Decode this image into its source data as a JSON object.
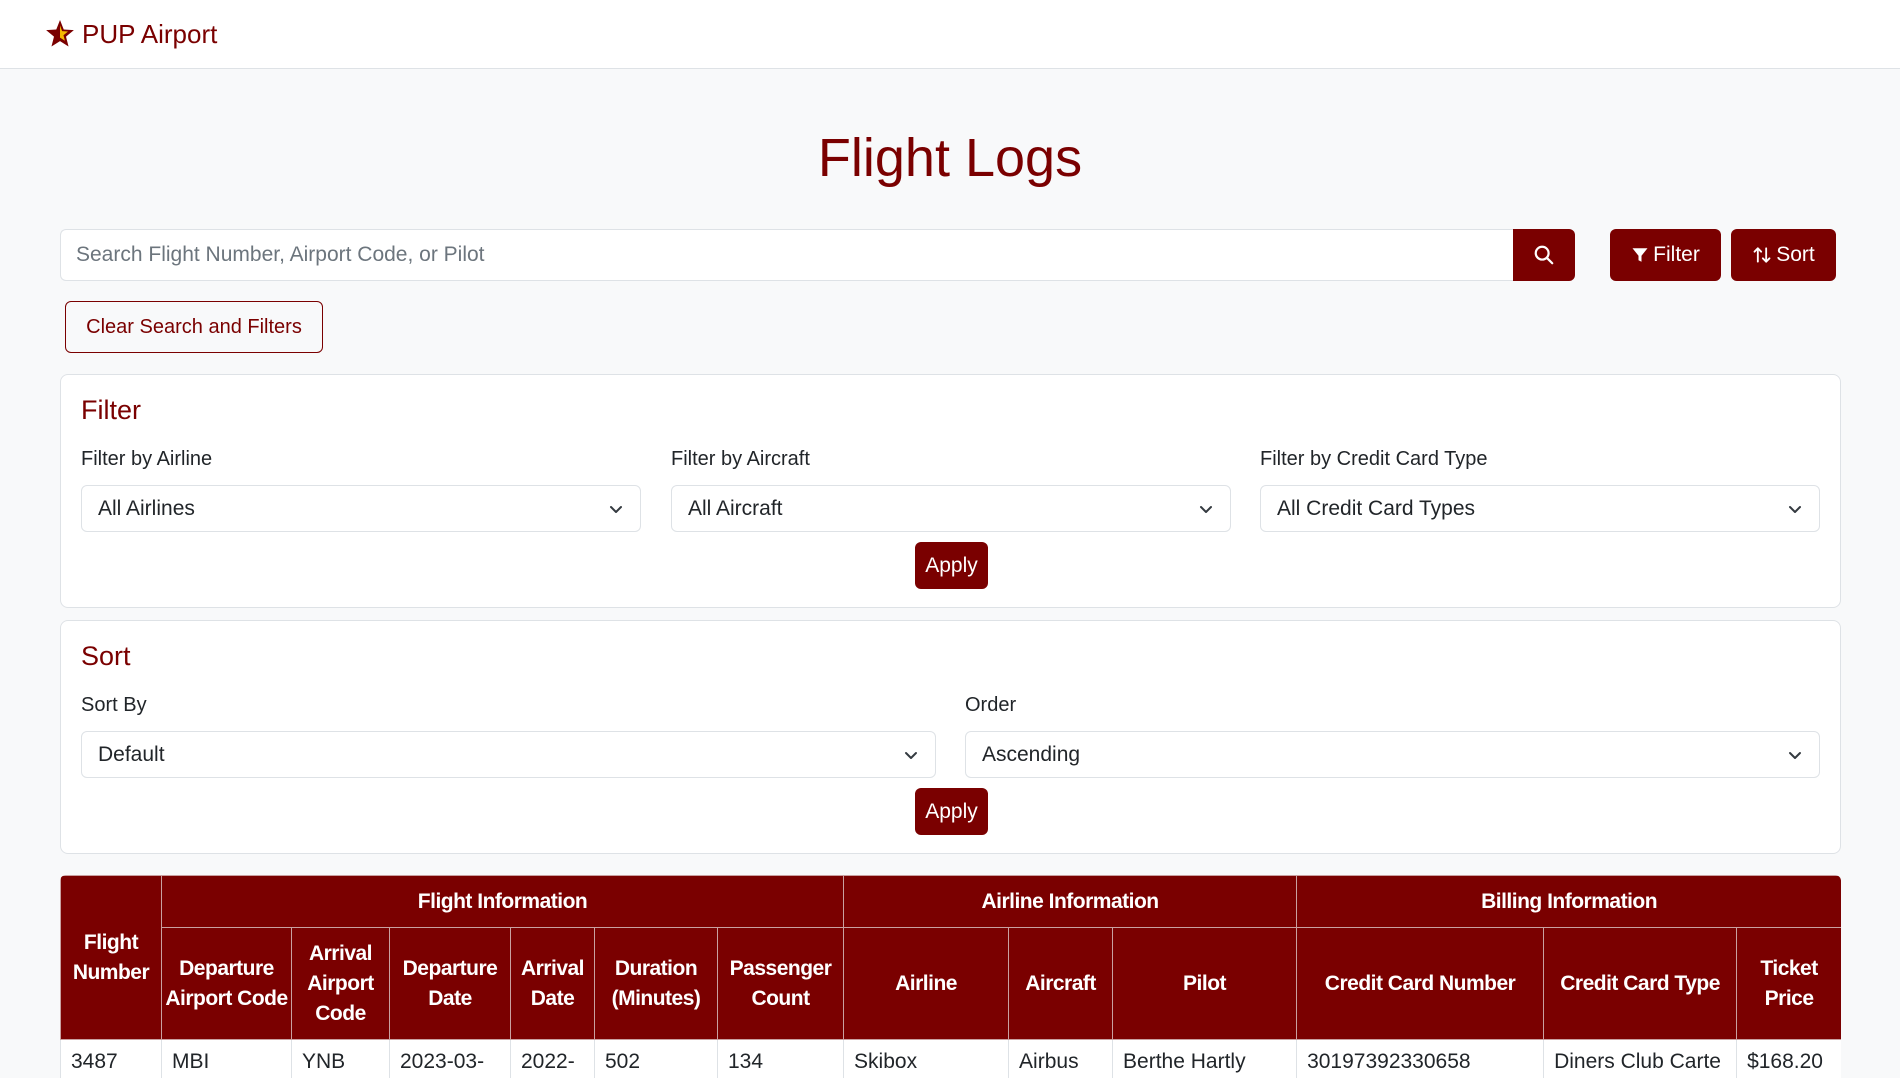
{
  "navbar": {
    "brand_text": "PUP Airport",
    "brand_icon": "star-icon"
  },
  "page": {
    "title": "Flight Logs"
  },
  "search": {
    "placeholder": "Search Flight Number, Airport Code, or Pilot",
    "button_icon": "search-icon"
  },
  "toolbar": {
    "filter_label": "Filter",
    "filter_icon": "funnel-icon",
    "sort_label": "Sort",
    "sort_icon": "sort-arrows-icon",
    "clear_label": "Clear Search and Filters"
  },
  "filter_panel": {
    "title": "Filter",
    "airline_label": "Filter by Airline",
    "airline_value": "All Airlines",
    "aircraft_label": "Filter by Aircraft",
    "aircraft_value": "All Aircraft",
    "card_type_label": "Filter by Credit Card Type",
    "card_type_value": "All Credit Card Types",
    "apply_label": "Apply"
  },
  "sort_panel": {
    "title": "Sort",
    "sort_by_label": "Sort By",
    "sort_by_value": "Default",
    "order_label": "Order",
    "order_value": "Ascending",
    "apply_label": "Apply"
  },
  "table": {
    "groups": {
      "flight_number": "Flight Number",
      "flight_info": "Flight Information",
      "airline_info": "Airline Information",
      "billing_info": "Billing Information"
    },
    "columns": {
      "departure_airport": "Departure Airport Code",
      "arrival_airport": "Arrival Airport Code",
      "departure_date": "Departure Date",
      "arrival_date": "Arrival Date",
      "duration": "Duration (Minutes)",
      "passenger_count": "Passenger Count",
      "airline": "Airline",
      "aircraft": "Aircraft",
      "pilot": "Pilot",
      "cc_number": "Credit Card Number",
      "cc_type": "Credit Card Type",
      "ticket_price": "Ticket Price"
    },
    "rows": [
      {
        "flight_number": "3487",
        "departure_airport": "MBI",
        "arrival_airport": "YNB",
        "departure_date": "2023-03-",
        "arrival_date": "2022-",
        "duration": "502",
        "passenger_count": "134",
        "airline": "Skibox",
        "aircraft": "Airbus",
        "pilot": "Berthe Hartly",
        "cc_number": "30197392330658",
        "cc_type": "Diners Club Carte",
        "ticket_price": "$168.20"
      }
    ]
  },
  "colors": {
    "accent": "#7a0000",
    "background": "#f8f9fa"
  }
}
